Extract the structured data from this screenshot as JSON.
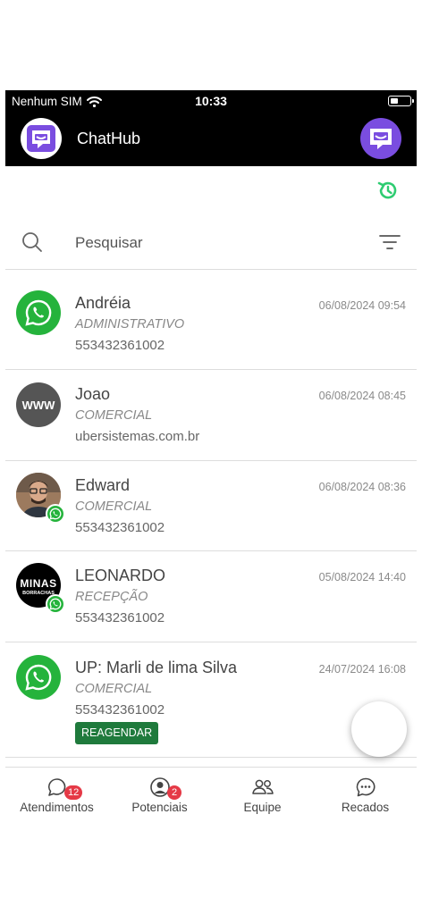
{
  "status_bar": {
    "carrier": "Nenhum SIM",
    "time": "10:33"
  },
  "header": {
    "title": "ChatHub"
  },
  "search": {
    "placeholder": "Pesquisar"
  },
  "conversations": [
    {
      "name": "Andréia",
      "department": "ADMINISTRATIVO",
      "contact": "553432361002",
      "datetime": "06/08/2024 09:54",
      "avatar": "whatsapp-logo"
    },
    {
      "name": "Joao",
      "department": "COMERCIAL",
      "contact": "ubersistemas.com.br",
      "datetime": "06/08/2024 08:45",
      "avatar": "www-logo",
      "avatar_text": "WWW"
    },
    {
      "name": "Edward",
      "department": "COMERCIAL",
      "contact": "553432361002",
      "datetime": "06/08/2024 08:36",
      "avatar": "profile-photo"
    },
    {
      "name": "LEONARDO",
      "department": "RECEPÇÃO",
      "contact": "553432361002",
      "datetime": "05/08/2024 14:40",
      "avatar": "minas-borrachas-logo",
      "avatar_text": "MINAS",
      "avatar_subtext": "BORRACHAS"
    },
    {
      "name": "UP: Marli de lima Silva",
      "department": "COMERCIAL",
      "contact": "553432361002",
      "datetime": "24/07/2024 16:08",
      "avatar": "whatsapp-logo",
      "action": "REAGENDAR"
    }
  ],
  "tabs": [
    {
      "label": "Atendimentos",
      "badge": "12",
      "icon": "chat-bubble-icon"
    },
    {
      "label": "Potenciais",
      "badge": "2",
      "icon": "person-circle-icon"
    },
    {
      "label": "Equipe",
      "icon": "people-icon"
    },
    {
      "label": "Recados",
      "icon": "message-dots-icon"
    }
  ],
  "colors": {
    "whatsapp": "#25b33c",
    "brand": "#7a4de0",
    "tag": "#1f7a3c",
    "badge": "#e53946",
    "history": "#2ecc71"
  }
}
